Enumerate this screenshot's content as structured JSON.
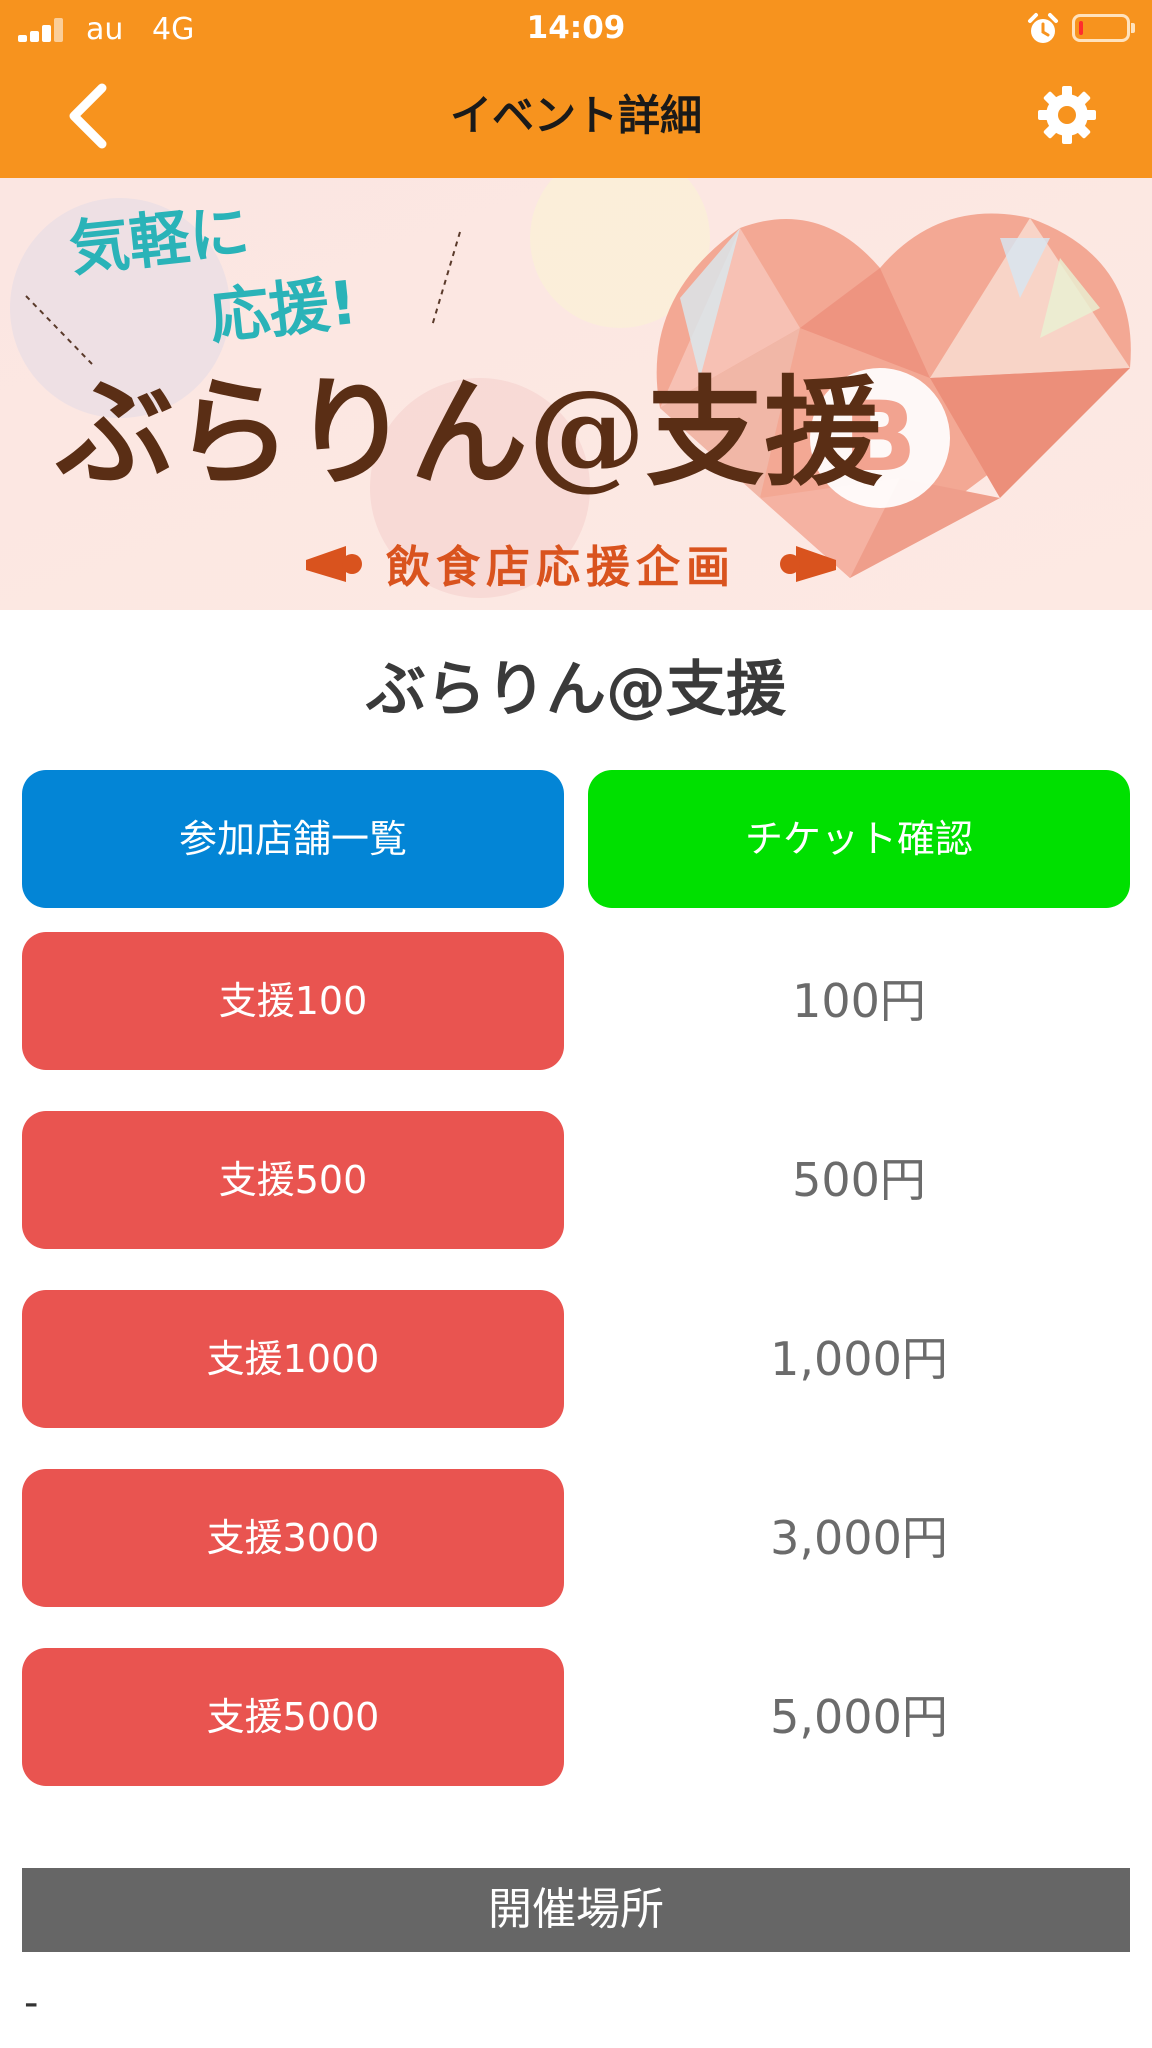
{
  "status_bar": {
    "carrier": "au",
    "network": "4G",
    "time": "14:09",
    "battery_level": 0.1,
    "icons": [
      "signal-icon",
      "alarm-icon",
      "battery-icon"
    ]
  },
  "nav": {
    "title": "イベント詳細",
    "back_icon": "chevron-left-icon",
    "settings_icon": "gear-icon"
  },
  "banner": {
    "tagline_line1": "気軽に",
    "tagline_line2": "応援!",
    "title": "ぶらりん@支援",
    "subtitle": "飲食店応援企画",
    "badge": "B"
  },
  "event": {
    "title": "ぶらりん@支援"
  },
  "actions": {
    "store_list": "参加店舗一覧",
    "ticket_check": "チケット確認"
  },
  "support_options": [
    {
      "label": "支援100",
      "price": "100円"
    },
    {
      "label": "支援500",
      "price": "500円"
    },
    {
      "label": "支援1000",
      "price": "1,000円"
    },
    {
      "label": "支援3000",
      "price": "3,000円"
    },
    {
      "label": "支援5000",
      "price": "5,000円"
    }
  ],
  "location": {
    "header": "開催場所",
    "value": "-"
  },
  "colors": {
    "nav_bar": "#f7931e",
    "blue_button": "#0385d6",
    "green_button": "#00e000",
    "red_button": "#e95450",
    "section_header": "#666666"
  }
}
